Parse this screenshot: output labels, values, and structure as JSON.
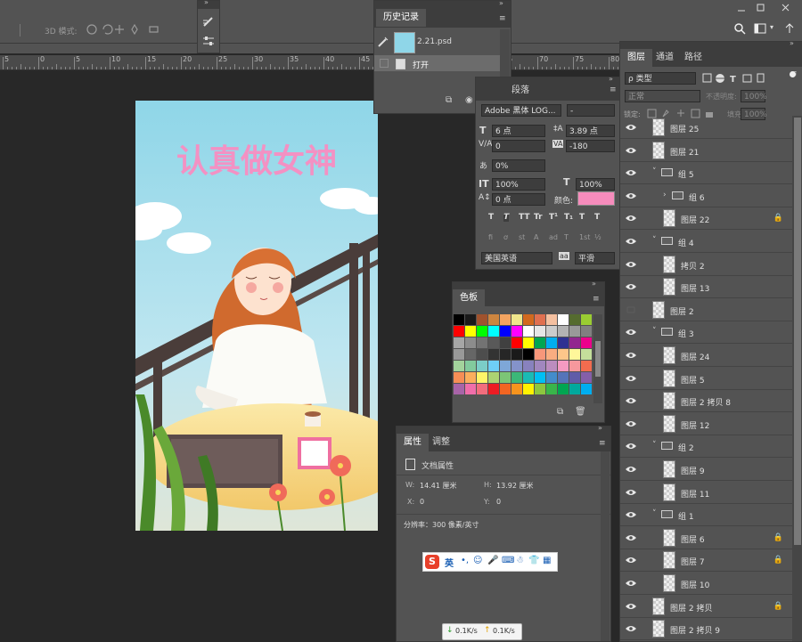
{
  "options_bar": {
    "mode3d_label": "3D 模式:"
  },
  "ruler": {
    "labels": [
      "5",
      "0",
      "5",
      "10",
      "15",
      "20",
      "25",
      "30",
      "35",
      "40",
      "45",
      "50",
      "55",
      "60",
      "65",
      "70",
      "75",
      "80"
    ]
  },
  "artwork": {
    "title_text": "认真做女神"
  },
  "history_panel": {
    "tab": "历史记录",
    "snapshot_name": "2.21.psd",
    "open_step": "打开"
  },
  "character_panel": {
    "tab_partial": "段落",
    "font_family": "Adobe 黑体 LOG...",
    "font_style": "-",
    "font_size": "6 点",
    "leading": "3.89 点",
    "kerning": "0",
    "tracking": "-180",
    "baseline_scale": "0%",
    "vertical_scale": "100%",
    "horizontal_scale": "100%",
    "baseline_shift": "0 点",
    "color_label": "颜色:",
    "color": "#f68cbc",
    "language": "美国英语",
    "aa_label": "aa",
    "antialias": "平滑",
    "style_buttons": [
      "T",
      "T",
      "TT",
      "Tr",
      "T¹",
      "T₁",
      "T",
      "T"
    ],
    "ot_buttons": [
      "fi",
      "ơ",
      "st",
      "A",
      "ad",
      "T",
      "1st",
      "½"
    ]
  },
  "swatches_panel": {
    "tab": "色板",
    "colors": [
      "#000000",
      "#1a1a1a",
      "#a0522d",
      "#cd853f",
      "#f4a460",
      "#f0e68c",
      "#d2691e",
      "#e07050",
      "#f5c0a0",
      "#ffffff",
      "#556b2f",
      "#9acd32",
      "#ff0000",
      "#ffff00",
      "#00ff00",
      "#00ffff",
      "#0000ff",
      "#ff00ff",
      "#ffffff",
      "#e6e6e6",
      "#cccccc",
      "#b3b3b3",
      "#999999",
      "#808080",
      "#a6a6a6",
      "#8c8c8c",
      "#737373",
      "#595959",
      "#404040",
      "#ff0000",
      "#ffff00",
      "#00a651",
      "#00aeef",
      "#2e3192",
      "#92278f",
      "#ec008c",
      "#999999",
      "#666666",
      "#4d4d4d",
      "#333333",
      "#262626",
      "#1a1a1a",
      "#000000",
      "#f7977a",
      "#f9ad81",
      "#fdc68a",
      "#fff79a",
      "#c4df9b",
      "#a3d39c",
      "#82ca9d",
      "#7bcdc8",
      "#6ecff6",
      "#7ea7d8",
      "#8493ca",
      "#8882be",
      "#a187be",
      "#bc8dbf",
      "#f49ac2",
      "#f6989d",
      "#f26c4f",
      "#f68e56",
      "#fbaf5d",
      "#fff568",
      "#acd373",
      "#7cc576",
      "#3bb878",
      "#1abbb4",
      "#00bff3",
      "#438ccb",
      "#5674b9",
      "#605ca8",
      "#855fa8",
      "#a864a8",
      "#f06eaa",
      "#f26d7d",
      "#ed1c24",
      "#f26522",
      "#f7941d",
      "#fff200",
      "#8dc63f",
      "#39b54a",
      "#00a651",
      "#00a99d",
      "#00aeef"
    ]
  },
  "properties_panel": {
    "tab_active": "属性",
    "tab_other": "调整",
    "section": "文档属性",
    "w_label": "W:",
    "w_value": "14.41 厘米",
    "h_label": "H:",
    "h_value": "13.92 厘米",
    "x_label": "X:",
    "x_value": "0",
    "y_label": "Y:",
    "y_value": "0",
    "resolution": "分辨率：300 像素/英寸"
  },
  "ime_bar": {
    "lang": "英"
  },
  "netspeed": {
    "down": "0.1K/s",
    "up": "0.1K/s"
  },
  "layers_panel": {
    "tabs": [
      "图层",
      "通道",
      "路径"
    ],
    "filter": "ρ 类型",
    "blend_mode": "正常",
    "opacity_label": "不透明度:",
    "opacity": "100%",
    "lock_label": "锁定:",
    "fill_label": "填充:",
    "fill": "100%",
    "layers": [
      {
        "name": "图层 25",
        "type": "layer",
        "indent": 0,
        "visible": true,
        "lock": false
      },
      {
        "name": "图层 21",
        "type": "layer",
        "indent": 0,
        "visible": true,
        "lock": false
      },
      {
        "name": "组 5",
        "type": "group",
        "indent": 0,
        "visible": true,
        "lock": false,
        "open": true
      },
      {
        "name": "组 6",
        "type": "group",
        "indent": 1,
        "visible": true,
        "lock": false,
        "open": false
      },
      {
        "name": "图层 22",
        "type": "layer",
        "indent": 1,
        "visible": true,
        "lock": true
      },
      {
        "name": "组 4",
        "type": "group",
        "indent": 0,
        "visible": true,
        "lock": false,
        "open": true
      },
      {
        "name": "拷贝 2",
        "type": "layer",
        "indent": 1,
        "visible": true,
        "lock": false
      },
      {
        "name": "图层 13",
        "type": "layer",
        "indent": 1,
        "visible": true,
        "lock": false
      },
      {
        "name": "图层 2",
        "type": "layer",
        "indent": 0,
        "visible": false,
        "lock": false
      },
      {
        "name": "组 3",
        "type": "group",
        "indent": 0,
        "visible": true,
        "lock": false,
        "open": true
      },
      {
        "name": "图层 24",
        "type": "layer",
        "indent": 1,
        "visible": true,
        "lock": false
      },
      {
        "name": "图层 5",
        "type": "layer",
        "indent": 1,
        "visible": true,
        "lock": false
      },
      {
        "name": "图层 2 拷贝 8",
        "type": "layer",
        "indent": 1,
        "visible": true,
        "lock": false
      },
      {
        "name": "图层 12",
        "type": "layer",
        "indent": 1,
        "visible": true,
        "lock": false
      },
      {
        "name": "组 2",
        "type": "group",
        "indent": 0,
        "visible": true,
        "lock": false,
        "open": true
      },
      {
        "name": "图层 9",
        "type": "layer",
        "indent": 1,
        "visible": true,
        "lock": false
      },
      {
        "name": "图层 11",
        "type": "layer",
        "indent": 1,
        "visible": true,
        "lock": false
      },
      {
        "name": "组 1",
        "type": "group",
        "indent": 0,
        "visible": true,
        "lock": false,
        "open": true
      },
      {
        "name": "图层 6",
        "type": "layer",
        "indent": 1,
        "visible": true,
        "lock": true
      },
      {
        "name": "图层 7",
        "type": "layer",
        "indent": 1,
        "visible": true,
        "lock": true
      },
      {
        "name": "图层 10",
        "type": "layer",
        "indent": 1,
        "visible": true,
        "lock": false
      },
      {
        "name": "图层 2 拷贝",
        "type": "layer",
        "indent": 0,
        "visible": true,
        "lock": true
      },
      {
        "name": "图层 2 拷贝 9",
        "type": "layer",
        "indent": 0,
        "visible": true,
        "lock": false
      }
    ]
  }
}
